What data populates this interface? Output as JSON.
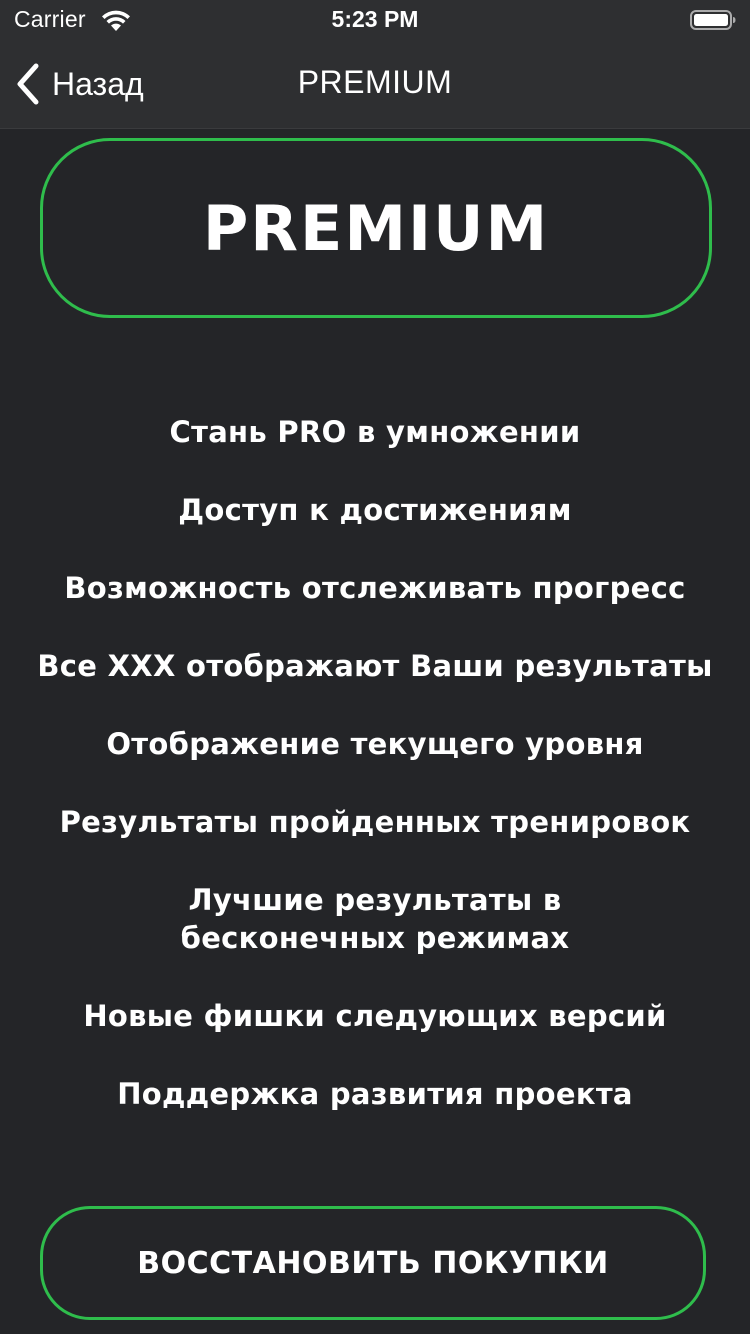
{
  "status_bar": {
    "carrier": "Carrier",
    "time": "5:23 PM"
  },
  "nav": {
    "back_label": "Назад",
    "title": "PREMIUM"
  },
  "premium": {
    "heading": "PREMIUM"
  },
  "features": [
    "Стань PRO в умножении",
    "Доступ к достижениям",
    "Возможность отслеживать прогресс",
    "Все XXX отображают Ваши результаты",
    "Отображение текущего уровня",
    "Результаты пройденных тренировок",
    "Лучшие результаты в",
    "бесконечных режимах",
    "Новые фишки следующих версий",
    "Поддержка развития проекта"
  ],
  "restore_button": {
    "label": "ВОССТАНОВИТЬ ПОКУПКИ"
  },
  "colors": {
    "background": "#242528",
    "bar": "#2e2f31",
    "accent": "#2fbd4c",
    "text": "#ffffff"
  }
}
